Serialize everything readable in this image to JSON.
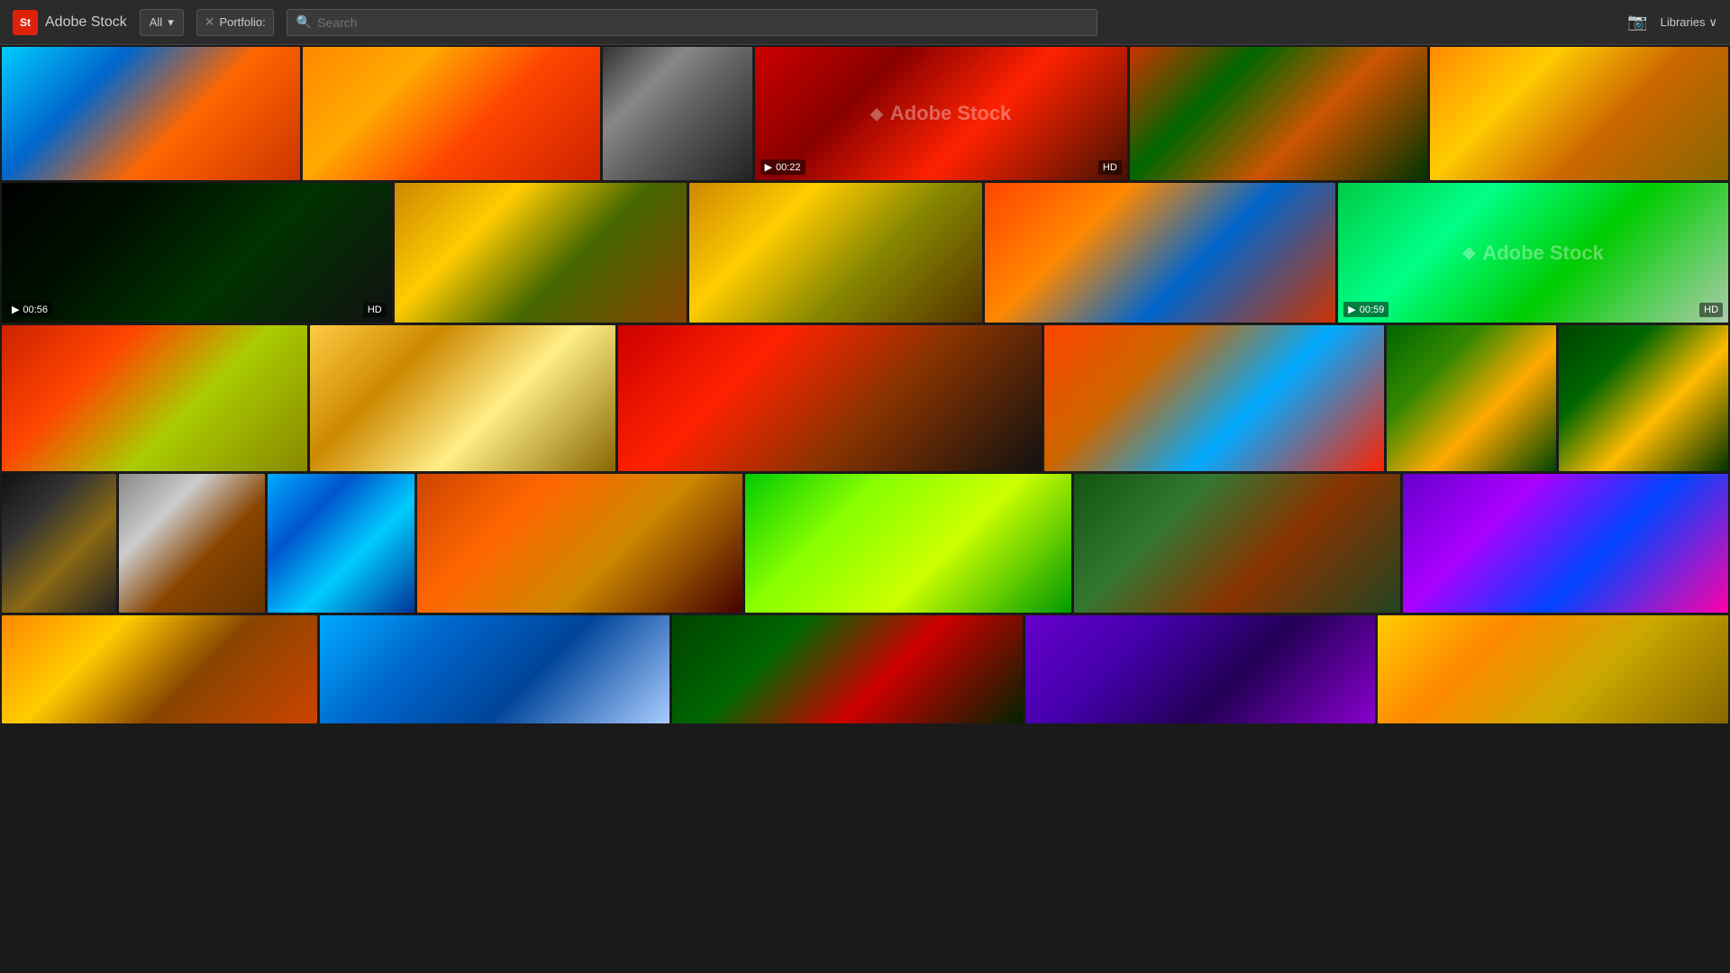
{
  "header": {
    "logo_text": "St",
    "app_title": "Adobe Stock",
    "filter_label": "All",
    "filter_arrow": "▾",
    "portfolio_label": "Portfolio:",
    "portfolio_close": "✕",
    "search_placeholder": "Search",
    "camera_icon": "📷",
    "libraries_label": "Libraries",
    "libraries_arrow": "∨"
  },
  "grid": {
    "row1": [
      {
        "id": "ferris-wheel",
        "type": "image",
        "class": "t-ferris",
        "flex": "1.6"
      },
      {
        "id": "fire-trees",
        "type": "image",
        "class": "t-fire-trees",
        "flex": "1.6"
      },
      {
        "id": "bw-tower",
        "type": "image",
        "class": "t-bw-tower",
        "flex": "0.8"
      },
      {
        "id": "red-smoke",
        "type": "video",
        "class": "t-red-smoke",
        "flex": "2",
        "duration": "00:22",
        "hd": true,
        "watermark": true
      },
      {
        "id": "red-forest",
        "type": "image",
        "class": "t-red-forest",
        "flex": "1.6"
      },
      {
        "id": "crane-bird",
        "type": "image",
        "class": "t-crane",
        "flex": "1.6"
      }
    ],
    "row2": [
      {
        "id": "dark-video",
        "type": "video",
        "class": "t-dark-video",
        "flex": "2",
        "duration": "00:56",
        "hd": true
      },
      {
        "id": "autumn-forest",
        "type": "image",
        "class": "t-autumn",
        "flex": "1.5"
      },
      {
        "id": "bird-yellow",
        "type": "image",
        "class": "t-bird",
        "flex": "1.5"
      },
      {
        "id": "sunset-water",
        "type": "image",
        "class": "t-sunset-water",
        "flex": "1.8"
      },
      {
        "id": "caterpillar",
        "type": "video",
        "class": "t-caterpillar",
        "flex": "2",
        "duration": "00:59",
        "hd": true,
        "watermark": true
      }
    ],
    "row3": [
      {
        "id": "red-horse",
        "type": "image",
        "class": "t-red-horse",
        "flex": "1.8"
      },
      {
        "id": "deer",
        "type": "image",
        "class": "t-deer",
        "flex": "1.8"
      },
      {
        "id": "silhouette",
        "type": "image",
        "class": "t-silhouette",
        "flex": "2.5"
      },
      {
        "id": "marsh-sunset",
        "type": "image",
        "class": "t-marsh-sunset",
        "flex": "2"
      },
      {
        "id": "forest-sun1",
        "type": "image",
        "class": "t-forest-sun1",
        "flex": "1"
      },
      {
        "id": "forest-sun2",
        "type": "image",
        "class": "t-forest-sun2",
        "flex": "1"
      }
    ],
    "row4": [
      {
        "id": "snail",
        "type": "image",
        "class": "t-snail",
        "flex": "0.7"
      },
      {
        "id": "shell",
        "type": "image",
        "class": "t-shell",
        "flex": "0.9"
      },
      {
        "id": "duck",
        "type": "image",
        "class": "t-duck",
        "flex": "0.9"
      },
      {
        "id": "foggy-sunset",
        "type": "image",
        "class": "t-foggy-sunset",
        "flex": "2"
      },
      {
        "id": "green-frog",
        "type": "image",
        "class": "t-green-frog",
        "flex": "2"
      },
      {
        "id": "waterfall",
        "type": "image",
        "class": "t-waterfall",
        "flex": "2"
      },
      {
        "id": "purple-light",
        "type": "image",
        "class": "t-purple-light",
        "flex": "2"
      }
    ],
    "row5": [
      {
        "id": "sunset-trees2",
        "type": "image",
        "class": "t-sunset-trees2",
        "flex": "1.8"
      },
      {
        "id": "blue-scene",
        "type": "image",
        "class": "t-blue-scene",
        "flex": "2"
      },
      {
        "id": "green-red",
        "type": "image",
        "class": "t-green-red",
        "flex": "2"
      },
      {
        "id": "purple-scene",
        "type": "image",
        "class": "t-purple-scene",
        "flex": "2"
      },
      {
        "id": "yellow-scene",
        "type": "image",
        "class": "t-yellow-scene",
        "flex": "2"
      }
    ]
  }
}
